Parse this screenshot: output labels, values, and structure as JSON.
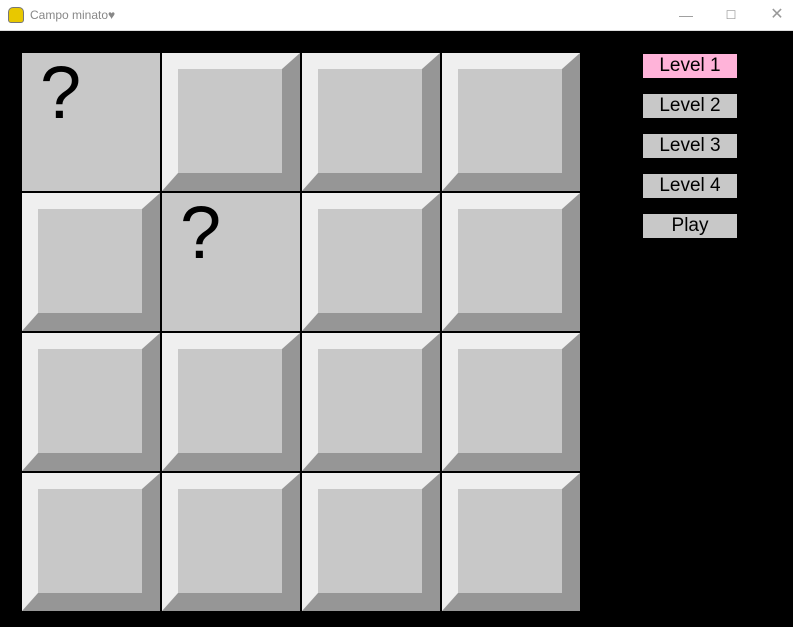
{
  "window": {
    "title": "Campo minato♥",
    "app_icon": "pygame-snake-icon",
    "controls": [
      "minimize-icon",
      "maximize-icon",
      "close-icon"
    ]
  },
  "board": {
    "rows": 4,
    "cols": 4,
    "revealed": [
      {
        "row": 0,
        "col": 0,
        "label": "?"
      },
      {
        "row": 1,
        "col": 1,
        "label": "?"
      }
    ]
  },
  "colors": {
    "selected_button": "#ffb3d9",
    "button": "#c8c8c8",
    "tile": "#c8c8c8",
    "tile_light": "#efefef",
    "tile_dark": "#969696"
  },
  "menu": {
    "buttons": [
      {
        "label": "Level 1",
        "selected": true
      },
      {
        "label": "Level 2"
      },
      {
        "label": "Level 3"
      },
      {
        "label": "Level 4"
      },
      {
        "label": "Play"
      }
    ]
  }
}
